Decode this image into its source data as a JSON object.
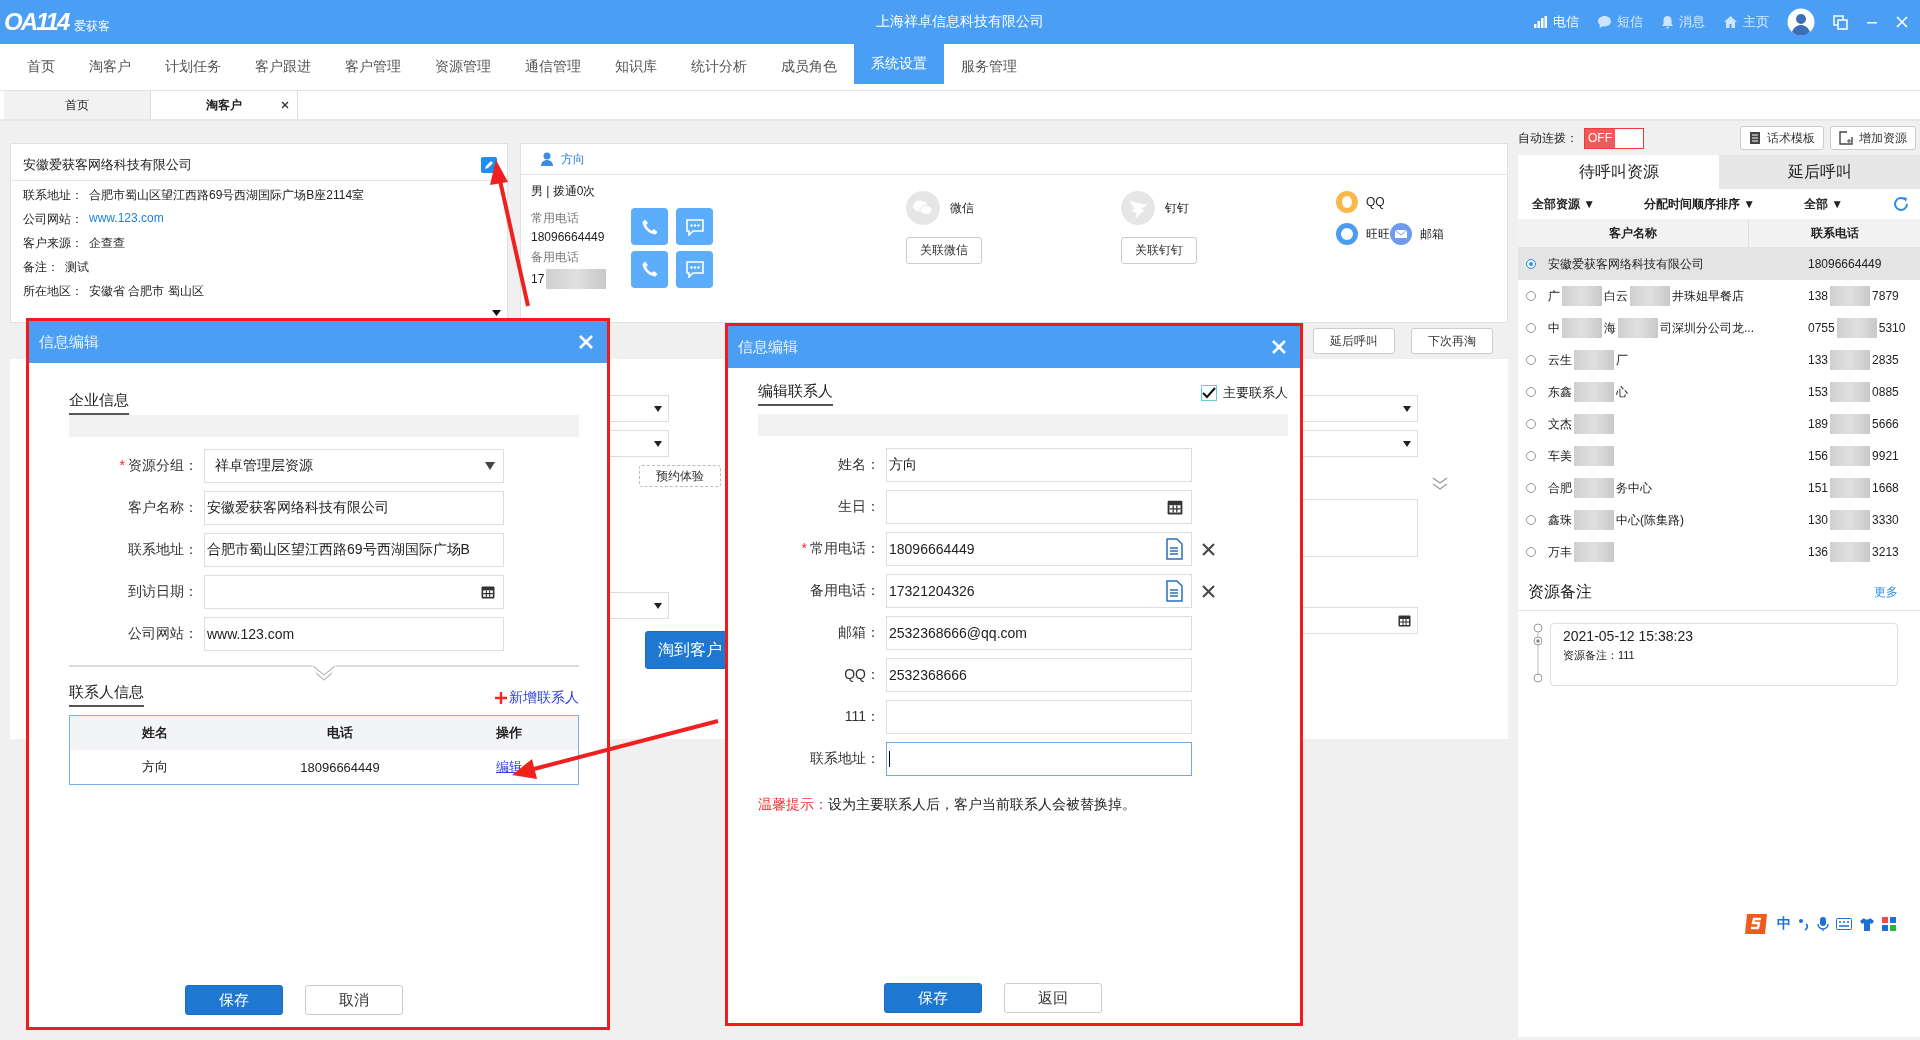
{
  "app": {
    "logo": "OA114",
    "brand": "爱获客",
    "title": "上海祥卓信息科技有限公司",
    "status_items": [
      {
        "kind": "signal",
        "label": "电信"
      },
      {
        "kind": "sms",
        "label": "短信"
      },
      {
        "kind": "bell",
        "label": "消息"
      },
      {
        "kind": "home",
        "label": "主页"
      }
    ]
  },
  "menu": [
    {
      "label": "首页",
      "selected": false
    },
    {
      "label": "淘客户",
      "selected": false
    },
    {
      "label": "计划任务",
      "selected": false
    },
    {
      "label": "客户跟进",
      "selected": false
    },
    {
      "label": "客户管理",
      "selected": false
    },
    {
      "label": "资源管理",
      "selected": false
    },
    {
      "label": "通信管理",
      "selected": false
    },
    {
      "label": "知识库",
      "selected": false
    },
    {
      "label": "统计分析",
      "selected": false
    },
    {
      "label": "成员角色",
      "selected": false
    },
    {
      "label": "系统设置",
      "selected": true
    },
    {
      "label": "服务管理",
      "selected": false
    }
  ],
  "tabs": [
    {
      "label": "首页",
      "selected": false,
      "closable": false
    },
    {
      "label": "淘客户",
      "selected": true,
      "closable": true
    }
  ],
  "company_card": {
    "name": "安徽爱获客网络科技有限公司",
    "fields": [
      {
        "kind": "text",
        "label": "联系地址：",
        "value": "合肥市蜀山区望江西路69号西湖国际广场B座2114室"
      },
      {
        "kind": "link",
        "label": "公司网站：",
        "value": "www.123.com"
      },
      {
        "kind": "text",
        "label": "客户来源：",
        "value": "企查查"
      },
      {
        "kind": "text",
        "label": "备注：",
        "value": "测试"
      },
      {
        "kind": "text",
        "label": "所在地区：",
        "value": "安徽省 合肥市 蜀山区"
      }
    ]
  },
  "contact_card": {
    "name": "方向",
    "summary": "男 | 拨通0次",
    "phones": [
      {
        "label": "常用电话",
        "number": "18096664449",
        "blurred": false
      },
      {
        "label": "备用电话",
        "number": "17",
        "blurred": true
      }
    ],
    "links": [
      {
        "kind": "wechat",
        "label": "微信",
        "button": "关联微信"
      },
      {
        "kind": "dingtalk",
        "label": "钉钉",
        "button": "关联钉钉"
      }
    ],
    "im": [
      {
        "kind": "qq",
        "label": "QQ"
      },
      {
        "kind": "wangwang",
        "label": "旺旺"
      },
      {
        "kind": "mail",
        "label": "邮箱"
      }
    ]
  },
  "actions": [
    "延后呼叫",
    "下次再淘"
  ],
  "background_form": {
    "buttons": [
      {
        "kind": "dashed",
        "label": "预约体验"
      },
      {
        "kind": "primary",
        "label": "淘到客户"
      }
    ]
  },
  "right_panel": {
    "auto_dial_label": "自动连拨：",
    "auto_dial": {
      "on": false,
      "label": "OFF"
    },
    "tools": [
      {
        "kind": "doc",
        "label": "话术模板"
      },
      {
        "kind": "add",
        "label": "增加资源"
      }
    ],
    "tabs": [
      {
        "label": "待呼叫资源",
        "selected": true
      },
      {
        "label": "延后呼叫",
        "selected": false
      }
    ],
    "filters": [
      "全部资源 ▼",
      "分配时间顺序排序 ▼",
      "全部 ▼"
    ],
    "columns": [
      "客户名称",
      "联系电话"
    ],
    "rows": [
      {
        "selected": true,
        "blurred": false,
        "name_parts": [
          "安徽爱获客网络科技有限公司"
        ],
        "phone_parts": [
          "18096664449"
        ]
      },
      {
        "selected": false,
        "blurred": true,
        "name_parts": [
          "广",
          "白云",
          "井珠姐早餐店"
        ],
        "phone_parts": [
          "138",
          "7879"
        ]
      },
      {
        "selected": false,
        "blurred": true,
        "name_parts": [
          "中",
          "海",
          "司深圳分公司龙..."
        ],
        "phone_parts": [
          "0755",
          "5310"
        ]
      },
      {
        "selected": false,
        "blurred": true,
        "name_parts": [
          "云生",
          "厂"
        ],
        "phone_parts": [
          "133",
          "2835"
        ]
      },
      {
        "selected": false,
        "blurred": true,
        "name_parts": [
          "东鑫",
          "心"
        ],
        "phone_parts": [
          "153",
          "0885"
        ]
      },
      {
        "selected": false,
        "blurred": true,
        "name_parts": [
          "文杰"
        ],
        "phone_parts": [
          "189",
          "5666"
        ]
      },
      {
        "selected": false,
        "blurred": true,
        "name_parts": [
          "车美"
        ],
        "phone_parts": [
          "156",
          "9921"
        ]
      },
      {
        "selected": false,
        "blurred": true,
        "name_parts": [
          "合肥",
          "务中心"
        ],
        "phone_parts": [
          "151",
          "1668"
        ]
      },
      {
        "selected": false,
        "blurred": true,
        "name_parts": [
          "鑫珠",
          "中心(陈集路)"
        ],
        "phone_parts": [
          "130",
          "3330"
        ]
      },
      {
        "selected": false,
        "blurred": true,
        "name_parts": [
          "万丰"
        ],
        "phone_parts": [
          "136",
          "3213"
        ]
      }
    ],
    "notes_title": "资源备注",
    "more": "更多",
    "notes": [
      {
        "time": "2021-05-12 15:38:23",
        "text": "资源备注：111"
      }
    ]
  },
  "enterprise_dialog": {
    "title": "信息编辑",
    "section": "企业信息",
    "fields": [
      {
        "kind": "select",
        "mark": "*",
        "label": "资源分组：",
        "value": "祥卓管理层资源"
      },
      {
        "kind": "text",
        "label": "客户名称：",
        "value": "安徽爱获客网络科技有限公司"
      },
      {
        "kind": "text",
        "label": "联系地址：",
        "value": "合肥市蜀山区望江西路69号西湖国际广场B"
      },
      {
        "kind": "date",
        "label": "到访日期："
      },
      {
        "kind": "text",
        "label": "公司网站：",
        "value": "www.123.com"
      }
    ],
    "contacts_section": "联系人信息",
    "add_label": "新增联系人",
    "table": {
      "columns": [
        "姓名",
        "电话",
        "操作"
      ],
      "rows": [
        {
          "name": "方向",
          "phone": "18096664449",
          "action": "编辑"
        }
      ]
    },
    "buttons": [
      {
        "kind": "primary",
        "label": "保存"
      },
      {
        "kind": "plain",
        "label": "取消"
      }
    ]
  },
  "contact_dialog": {
    "title": "信息编辑",
    "section": "编辑联系人",
    "primary": {
      "label": "主要联系人",
      "checked": true
    },
    "fields": [
      {
        "kind": "text",
        "label": "姓名：",
        "value": "方向",
        "focused": false
      },
      {
        "kind": "date",
        "label": "生日：",
        "focused": false
      },
      {
        "kind": "phone",
        "mark": "*",
        "label": "常用电话：",
        "value": "18096664449",
        "focused": false
      },
      {
        "kind": "phone",
        "label": "备用电话：",
        "value": "17321204326",
        "focused": false
      },
      {
        "kind": "text",
        "label": "邮箱：",
        "value": "2532368666@qq.com",
        "focused": false
      },
      {
        "kind": "text",
        "label": "QQ：",
        "value": "2532368666",
        "focused": false
      },
      {
        "kind": "text",
        "label": "111：",
        "focused": false
      },
      {
        "kind": "text",
        "label": "联系地址：",
        "focused": true
      }
    ],
    "hint": {
      "label": "温馨提示：",
      "text": "设为主要联系人后，客户当前联系人会被替换掉。"
    },
    "buttons": [
      {
        "kind": "primary",
        "label": "保存"
      },
      {
        "kind": "plain",
        "label": "返回"
      }
    ]
  },
  "ime": {
    "mode": "中"
  }
}
